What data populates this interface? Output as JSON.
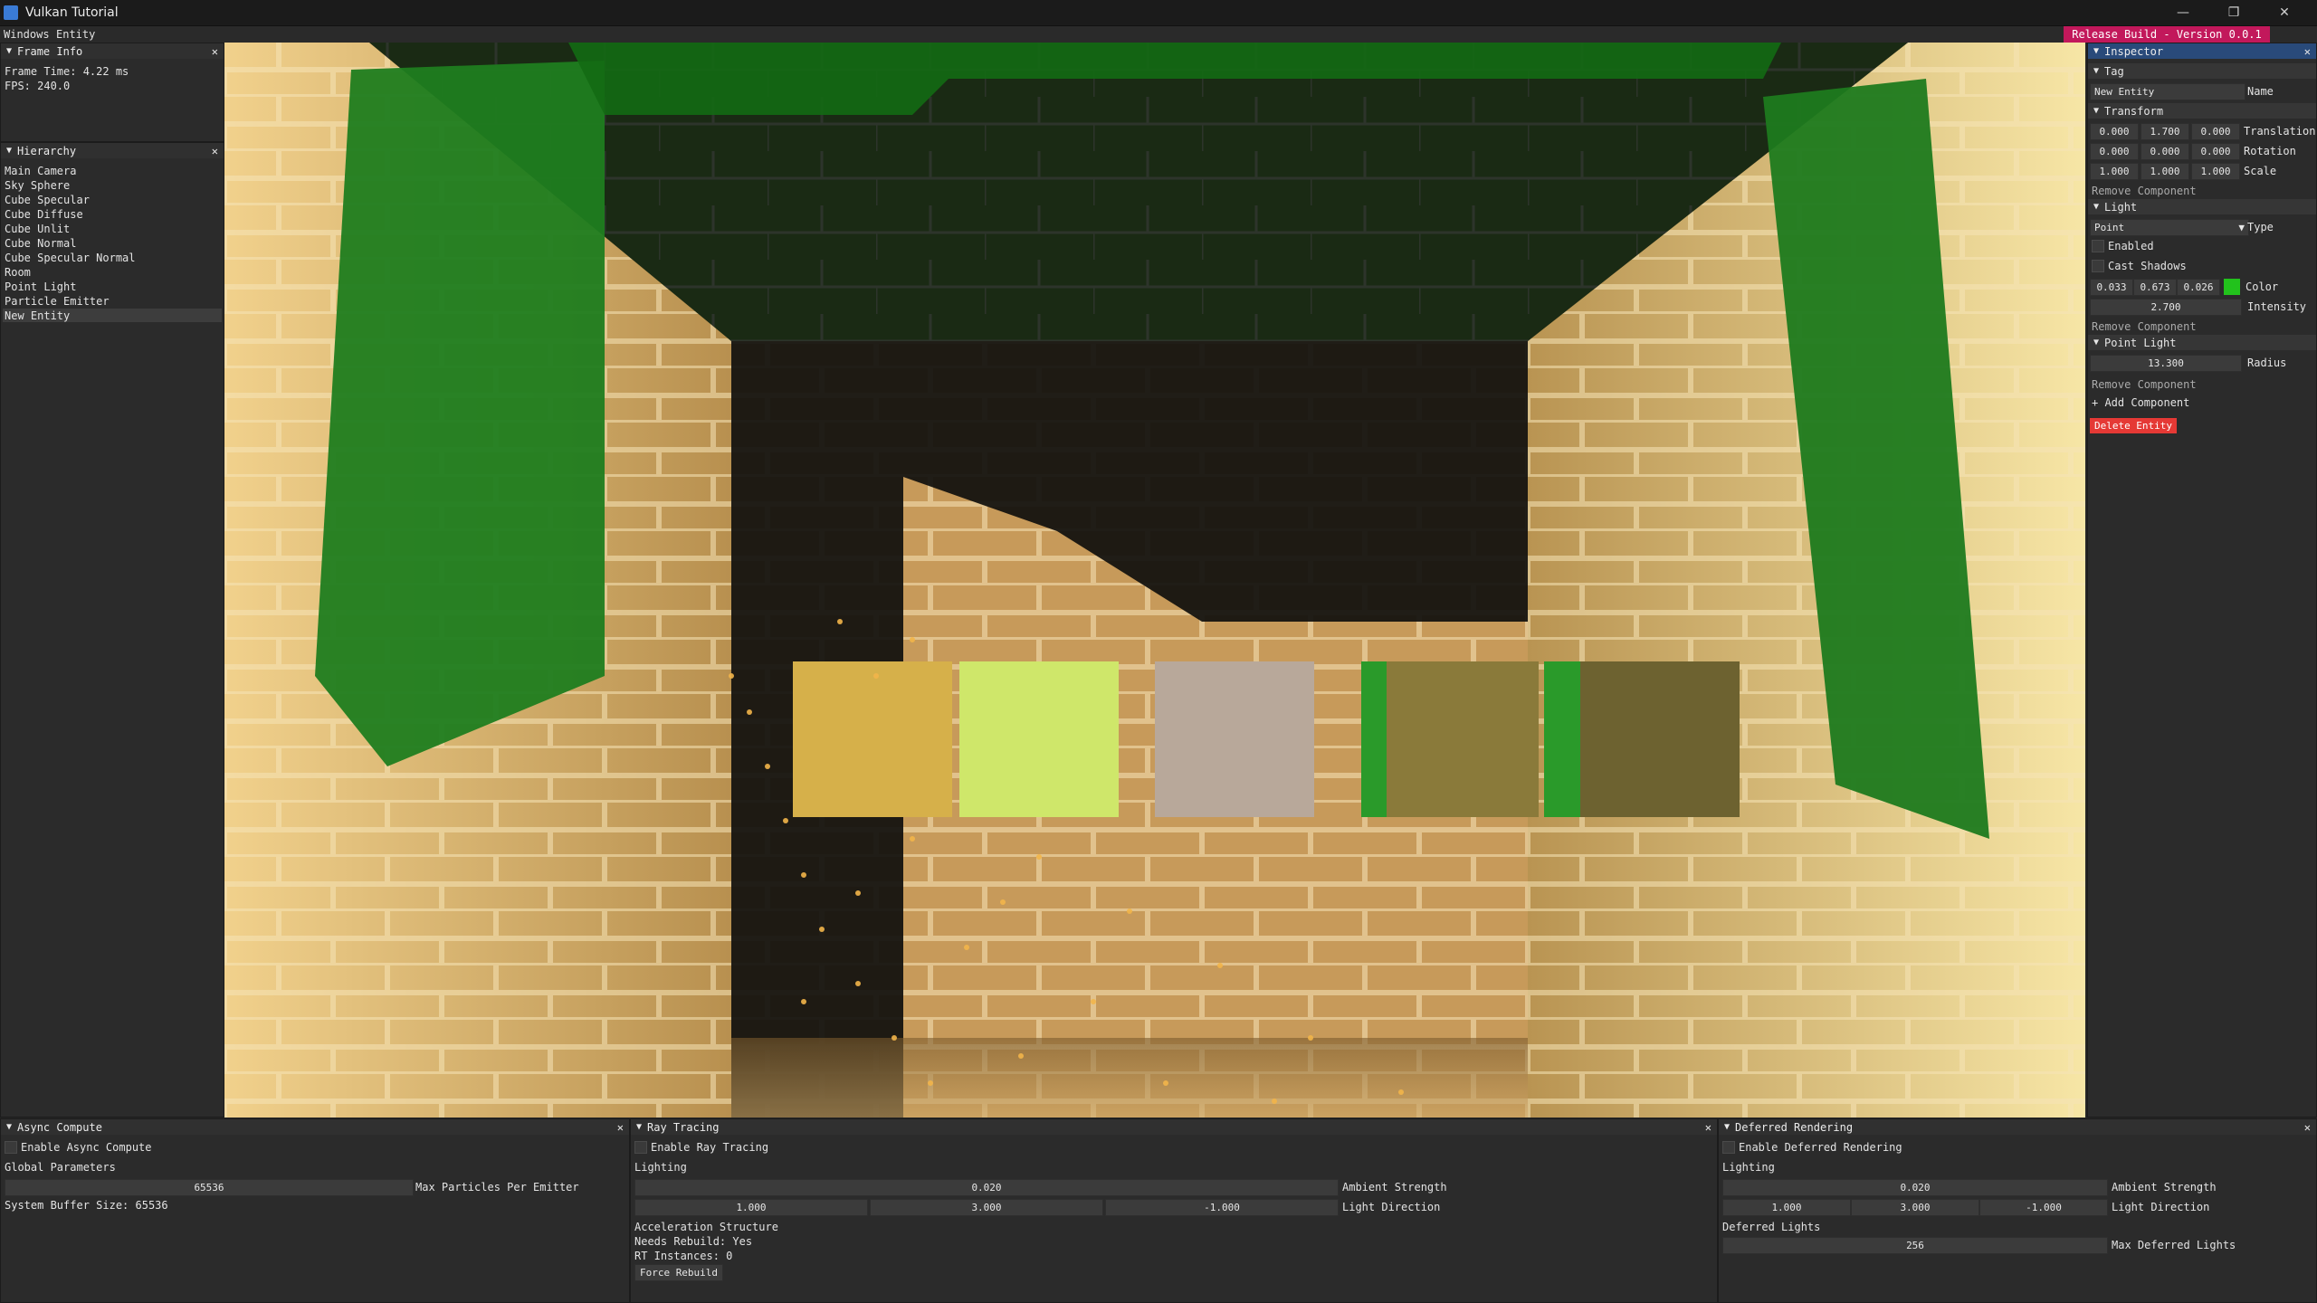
{
  "window": {
    "title": "Vulkan Tutorial",
    "min": "—",
    "max": "❐",
    "close": "✕"
  },
  "menu": {
    "items": [
      "Windows",
      "Entity"
    ]
  },
  "release_badge": "Release Build - Version 0.0.1",
  "frame_info": {
    "title": "Frame Info",
    "frame_time": "Frame Time: 4.22 ms",
    "fps": "FPS: 240.0"
  },
  "hierarchy": {
    "title": "Hierarchy",
    "items": [
      "Main Camera",
      "Sky Sphere",
      "Cube Specular",
      "Cube Diffuse",
      "Cube Unlit",
      "Cube Normal",
      "Cube Specular Normal",
      "Room",
      "Point Light",
      "Particle Emitter",
      "New Entity"
    ],
    "selected": "New Entity"
  },
  "inspector": {
    "title": "Inspector",
    "tag": {
      "header": "Tag",
      "value": "New Entity",
      "label": "Name"
    },
    "transform": {
      "header": "Transform",
      "translation": [
        "0.000",
        "1.700",
        "0.000"
      ],
      "translation_label": "Translation",
      "rotation": [
        "0.000",
        "0.000",
        "0.000"
      ],
      "rotation_label": "Rotation",
      "scale": [
        "1.000",
        "1.000",
        "1.000"
      ],
      "scale_label": "Scale",
      "remove": "Remove Component"
    },
    "light": {
      "header": "Light",
      "type_value": "Point",
      "type_label": "Type",
      "enabled": "Enabled",
      "cast_shadows": "Cast Shadows",
      "color": [
        "0.033",
        "0.673",
        "0.026"
      ],
      "color_label": "Color",
      "color_swatch": "#22c21c",
      "intensity": "2.700",
      "intensity_label": "Intensity",
      "remove": "Remove Component"
    },
    "point_light": {
      "header": "Point Light",
      "radius": "13.300",
      "radius_label": "Radius",
      "remove": "Remove Component"
    },
    "add_component": "+ Add Component",
    "delete_entity": "Delete Entity"
  },
  "async_compute": {
    "title": "Async Compute",
    "enable": "Enable Async Compute",
    "global_params": "Global Parameters",
    "max_particles": "65536",
    "max_particles_label": "Max Particles Per Emitter",
    "buffer_size": "System Buffer Size: 65536"
  },
  "ray_tracing": {
    "title": "Ray Tracing",
    "enable": "Enable Ray Tracing",
    "lighting": "Lighting",
    "ambient": "0.020",
    "ambient_label": "Ambient Strength",
    "dir": [
      "1.000",
      "3.000",
      "-1.000"
    ],
    "dir_label": "Light Direction",
    "accel": "Acceleration Structure",
    "needs_rebuild": "Needs Rebuild: Yes",
    "rt_instances": "RT Instances: 0",
    "force_rebuild": "Force Rebuild"
  },
  "deferred": {
    "title": "Deferred Rendering",
    "enable": "Enable Deferred Rendering",
    "lighting": "Lighting",
    "ambient": "0.020",
    "ambient_label": "Ambient Strength",
    "dir": [
      "1.000",
      "3.000",
      "-1.000"
    ],
    "dir_label": "Light Direction",
    "deferred_lights": "Deferred Lights",
    "max_lights": "256",
    "max_lights_label": "Max Deferred Lights"
  }
}
